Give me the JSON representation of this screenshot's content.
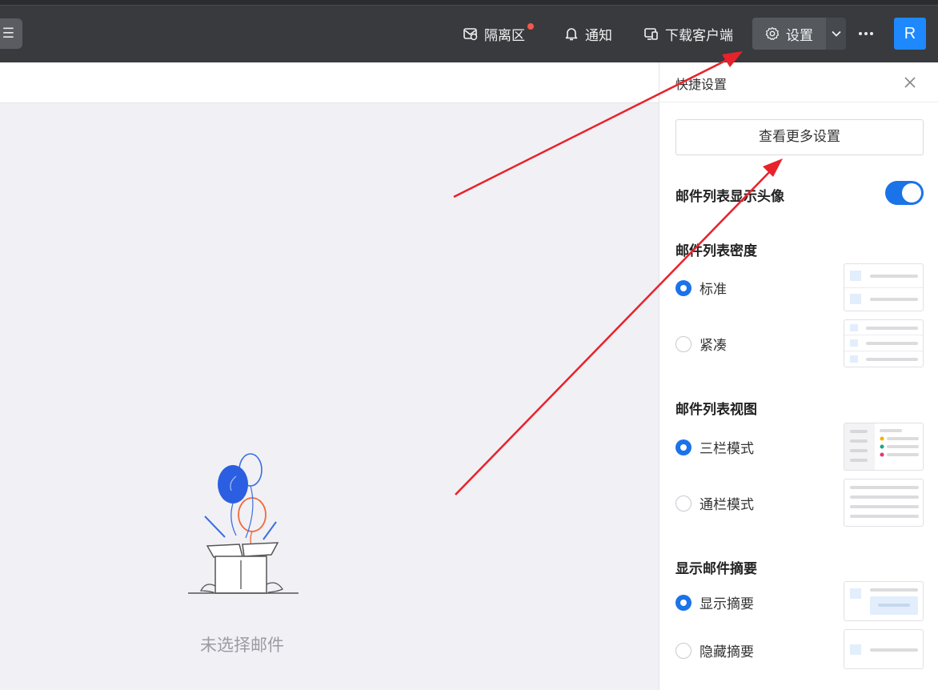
{
  "topbar": {
    "filter_icon": "sliders-icon",
    "quarantine_label": "隔离区",
    "notify_label": "通知",
    "download_label": "下载客户端",
    "settings_label": "设置",
    "avatar_letter": "R",
    "colors": {
      "bar": "#383a3e",
      "dot": "#f4574b",
      "avatar": "#1e88ff"
    }
  },
  "main": {
    "empty_text": "未选择邮件"
  },
  "panel": {
    "title": "快捷设置",
    "more_settings_label": "查看更多设置",
    "avatar_toggle_label": "邮件列表显示头像",
    "avatar_toggle_on": true,
    "density": {
      "title": "邮件列表密度",
      "options": [
        {
          "label": "标准",
          "selected": true
        },
        {
          "label": "紧凑",
          "selected": false
        }
      ]
    },
    "view": {
      "title": "邮件列表视图",
      "options": [
        {
          "label": "三栏模式",
          "selected": true
        },
        {
          "label": "通栏模式",
          "selected": false
        }
      ]
    },
    "summary": {
      "title": "显示邮件摘要",
      "options": [
        {
          "label": "显示摘要",
          "selected": true
        },
        {
          "label": "隐藏摘要",
          "selected": false
        }
      ]
    },
    "accent_color": "#1a73e8"
  }
}
